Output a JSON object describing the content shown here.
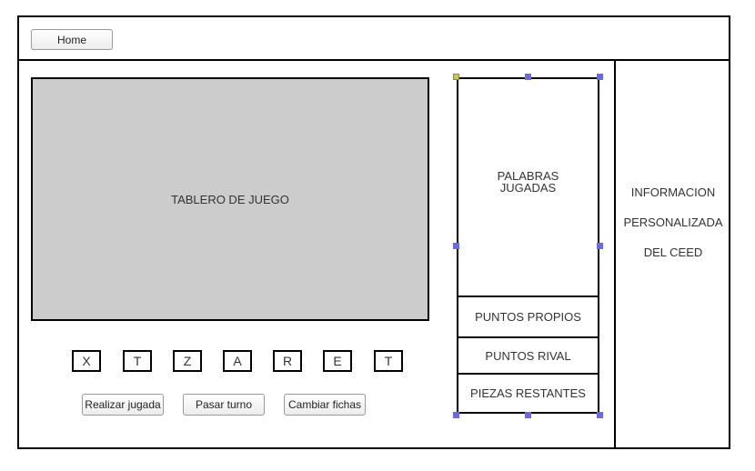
{
  "header": {
    "home_label": "Home"
  },
  "board": {
    "label": "TABLERO DE JUEGO"
  },
  "rack": {
    "tiles": [
      "X",
      "T",
      "Z",
      "A",
      "R",
      "E",
      "T"
    ]
  },
  "actions": {
    "play_label": "Realizar jugada",
    "pass_label": "Pasar turno",
    "swap_label": "Cambiar fichas"
  },
  "score_panel": {
    "words_line1": "PALABRAS",
    "words_line2": "JUGADAS",
    "own_points": "PUNTOS PROPIOS",
    "rival_points": "PUNTOS RIVAL",
    "remaining_pieces": "PIEZAS RESTANTES"
  },
  "info": {
    "line1": "INFORMACION",
    "line2": "PERSONALIZADA",
    "line3": "DEL CEED"
  }
}
